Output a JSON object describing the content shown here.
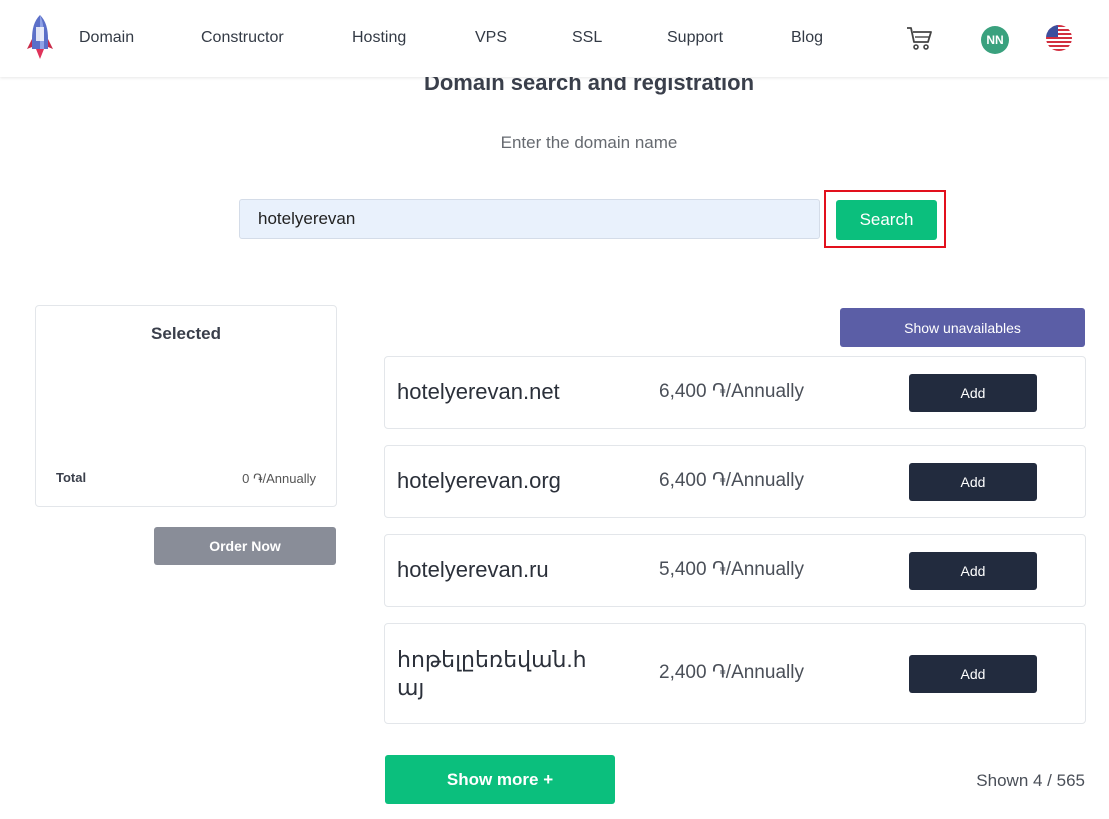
{
  "nav": {
    "items": [
      {
        "label": "Domain"
      },
      {
        "label": "Constructor"
      },
      {
        "label": "Hosting"
      },
      {
        "label": "VPS"
      },
      {
        "label": "SSL"
      },
      {
        "label": "Support"
      },
      {
        "label": "Blog"
      }
    ],
    "avatar_initials": "NN",
    "cart_icon": "cart-icon",
    "flag_icon": "us-flag-icon"
  },
  "search": {
    "title": "Domain search and registration",
    "subtitle": "Enter the domain name",
    "value": "hotelyerevan",
    "button_label": "Search"
  },
  "selected": {
    "title": "Selected",
    "total_label": "Total",
    "total_value": "0 ֏/Annually",
    "order_label": "Order Now"
  },
  "results": {
    "show_unavailable_label": "Show unavailables",
    "items": [
      {
        "domain": "hotelyerevan.net",
        "price": "6,400 ֏/Annually",
        "add_label": "Add"
      },
      {
        "domain": "hotelyerevan.org",
        "price": "6,400 ֏/Annually",
        "add_label": "Add"
      },
      {
        "domain": "hotelyerevan.ru",
        "price": "5,400 ֏/Annually",
        "add_label": "Add"
      },
      {
        "domain": "հոթելըեռեվան.հայ",
        "price": "2,400 ֏/Annually",
        "add_label": "Add"
      }
    ],
    "show_more_label": "Show more +",
    "shown_count": "Shown 4 / 565"
  },
  "colors": {
    "accent_green": "#0bbf7d",
    "dark_button": "#222b3e",
    "purple_button": "#5b5ea6",
    "highlight_red": "#e2101d"
  }
}
